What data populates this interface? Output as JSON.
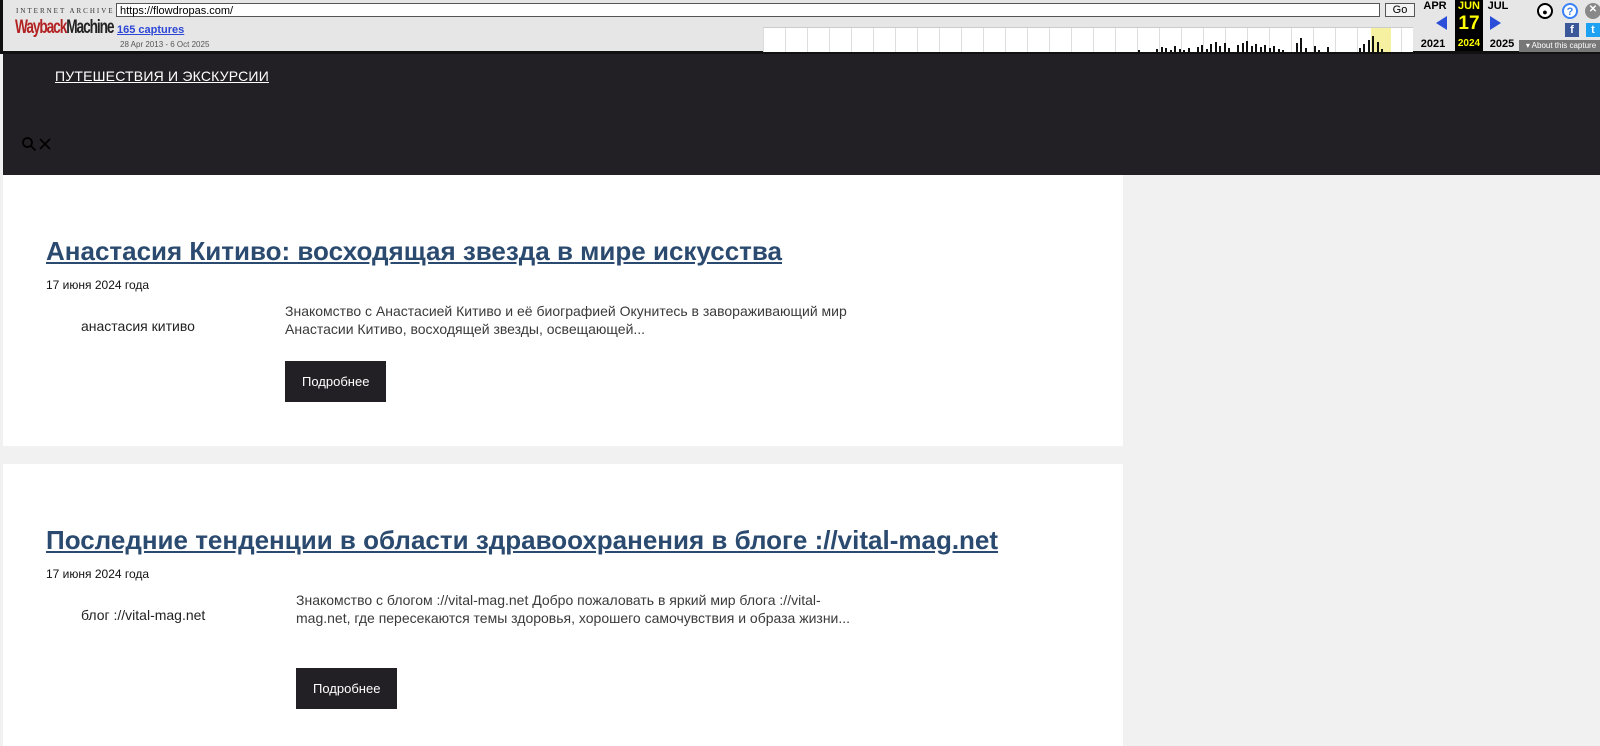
{
  "wayback": {
    "logo_top": "INTERNET ARCHIVE",
    "logo_main_a": "Wayback",
    "logo_main_b": "Machine",
    "url": "https://flowdropas.com/",
    "go_label": "Go",
    "captures_label": "165 captures",
    "range_label": "28 Apr 2013 - 6 Oct 2025",
    "prev_month": "APR",
    "cur_month": "JUN",
    "next_month": "JUL",
    "cur_day": "17",
    "prev_year": "2021",
    "cur_year": "2024",
    "next_year": "2025",
    "about_label": "▾ About this capture",
    "icons": [
      "user-icon",
      "help-icon",
      "close-icon",
      "facebook-icon",
      "twitter-icon"
    ]
  },
  "header": {
    "nav_label": "ПУТЕШЕСТВИЯ И ЭКСКУРСИИ"
  },
  "posts": [
    {
      "title": "Анастасия Китиво: восходящая звезда в мире искусства",
      "date": "17 июня 2024 года",
      "image_alt": "анастасия китиво",
      "excerpt": "Знакомство с Анастасией Китиво и её биографией Окунитесь в завораживающий мир Анастасии Китиво, восходящей звезды, освещающей...",
      "button_label": "Подробнее"
    },
    {
      "title": "Последние тенденции в области здравоохранения в блоге ://vital-mag.net",
      "date": "17 июня 2024 года",
      "image_alt": "блог ://vital-mag.net",
      "excerpt": "Знакомство с блогом ://vital-mag.net Добро пожаловать в яркий мир блога ://vital-mag.net, где пересекаются темы здоровья, хорошего самочувствия и образа жизни...",
      "button_label": "Подробнее"
    }
  ]
}
